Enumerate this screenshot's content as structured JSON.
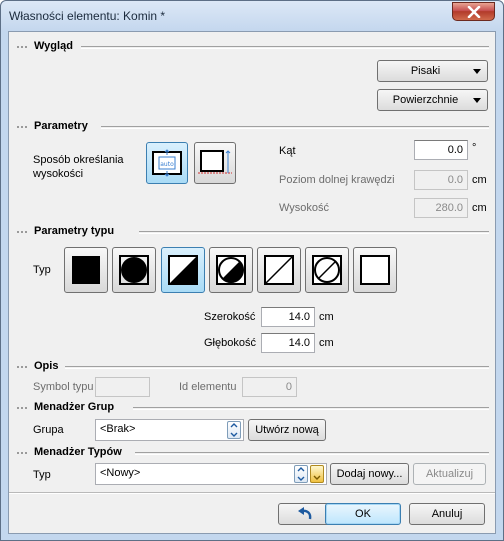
{
  "window": {
    "title": "Własności elementu: Komin *"
  },
  "sections": {
    "appearance": "Wygląd",
    "parameters": "Parametry",
    "type_parameters": "Parametry typu",
    "description": "Opis",
    "group_manager": "Menadżer Grup",
    "type_manager": "Menadżer Typów"
  },
  "appearance": {
    "pens_label": "Pisaki",
    "surfaces_label": "Powierzchnie"
  },
  "parameters": {
    "height_mode_label": "Sposób określania wysokości",
    "angle_label": "Kąt",
    "angle_value": "0.0",
    "angle_unit": "°",
    "bottom_level_label": "Poziom dolnej krawędzi",
    "bottom_level_value": "0.0",
    "bottom_level_unit": "cm",
    "height_label": "Wysokość",
    "height_value": "280.0",
    "height_unit": "cm",
    "auto_icon_text": "auto"
  },
  "type_parameters": {
    "type_label": "Typ",
    "width_label": "Szerokość",
    "width_value": "14.0",
    "width_unit": "cm",
    "depth_label": "Głębokość",
    "depth_value": "14.0",
    "depth_unit": "cm"
  },
  "description": {
    "symbol_label": "Symbol typu",
    "symbol_value": "",
    "id_label": "Id elementu",
    "id_value": "0"
  },
  "group_manager": {
    "group_label": "Grupa",
    "group_value": "<Brak>",
    "create_new_label": "Utwórz nową"
  },
  "type_manager": {
    "type_label": "Typ",
    "type_value": "<Nowy>",
    "add_new_label": "Dodaj nowy...",
    "update_label": "Aktualizuj"
  },
  "footer": {
    "ok_label": "OK",
    "cancel_label": "Anuluj"
  }
}
